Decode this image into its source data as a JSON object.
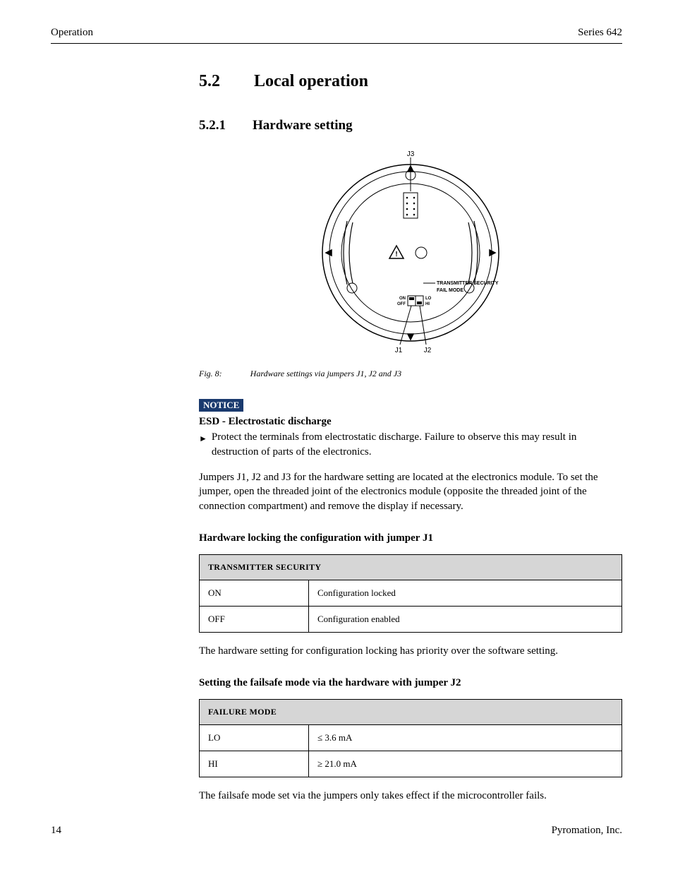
{
  "header": {
    "left": "Operation",
    "right": "Series 642"
  },
  "section": {
    "num": "5.2",
    "title": "Local operation"
  },
  "subsection": {
    "num": "5.2.1",
    "title": "Hardware setting"
  },
  "figure": {
    "labels": {
      "j1": "J1",
      "j2": "J2",
      "j3": "J3"
    },
    "inside": {
      "line1": "TRANSMITTER SECURITY",
      "line2": "FAIL MODE",
      "on": "ON",
      "off": "OFF",
      "lo": "LO",
      "hi": "HI"
    },
    "caption_num": "Fig. 8:",
    "caption_text": "Hardware settings via jumpers J1, J2 and J3"
  },
  "notice": {
    "badge": "NOTICE",
    "title": "ESD - Electrostatic discharge",
    "bullet": "Protect the terminals from electrostatic discharge. Failure to observe this may result in destruction of parts of the electronics."
  },
  "para_jumpers": "Jumpers J1, J2 and J3 for the hardware setting are located at the electronics module. To set the jumper, open the threaded joint of the electronics module (opposite the threaded joint of the connection compartment) and remove the display if necessary.",
  "h4_j1": "Hardware locking the configuration with jumper J1",
  "table_j1": {
    "header": "TRANSMITTER SECURITY",
    "rows": [
      {
        "k": "ON",
        "v": "Configuration locked"
      },
      {
        "k": "OFF",
        "v": "Configuration enabled"
      }
    ]
  },
  "para_priority": "The hardware setting for configuration locking has priority over the software setting.",
  "h4_j2": "Setting the failsafe mode via the hardware with jumper J2",
  "table_j2": {
    "header": "FAILURE MODE",
    "rows": [
      {
        "k": "LO",
        "v": "≤ 3.6 mA"
      },
      {
        "k": "HI",
        "v": "≥ 21.0 mA"
      }
    ]
  },
  "para_failsafe": "The failsafe mode set via the jumpers only takes effect if the microcontroller fails.",
  "footer": {
    "page": "14",
    "company": "Pyromation, Inc."
  }
}
